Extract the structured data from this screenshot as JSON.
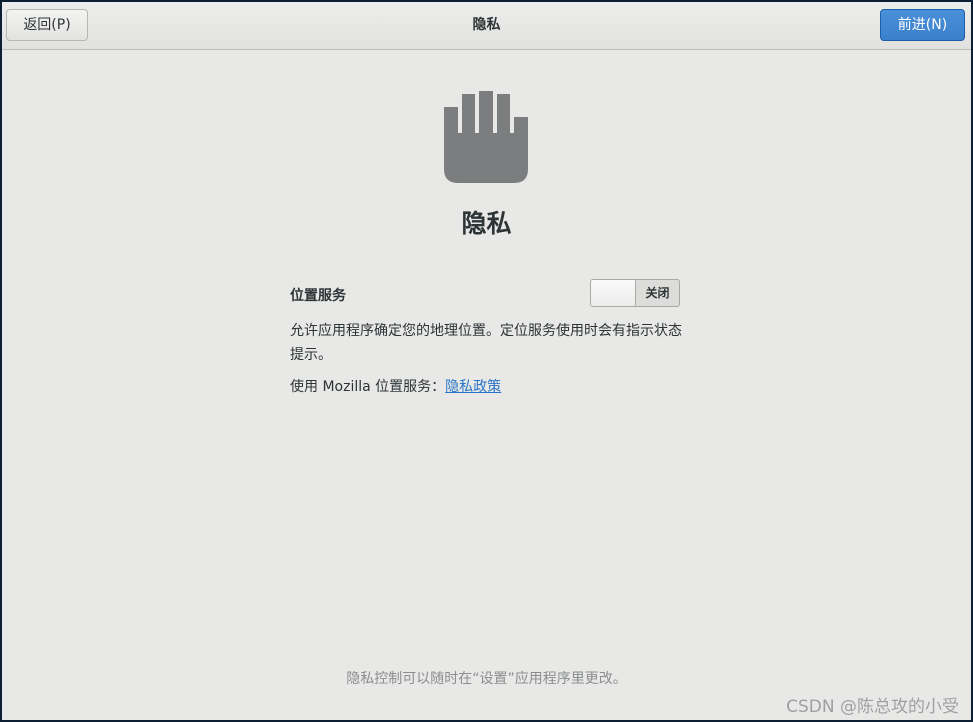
{
  "header": {
    "back_label": "返回(P)",
    "title": "隐私",
    "next_label": "前进(N)"
  },
  "page": {
    "icon": "hand-stop-icon",
    "title": "隐私"
  },
  "location": {
    "label": "位置服务",
    "toggle_state": "关闭",
    "toggle_on": false,
    "description": "允许应用程序确定您的地理位置。定位服务使用时会有指示状态提示。",
    "policy_prefix": "使用 Mozilla 位置服务：",
    "policy_link": "隐私政策"
  },
  "footer": {
    "note": "隐私控制可以随时在“设置”应用程序里更改。"
  },
  "watermark": "CSDN @陈总攻的小受",
  "colors": {
    "accent": "#4a90d9",
    "link": "#2a76c6",
    "icon": "#7b7d7e",
    "background": "#e8e8e7"
  }
}
